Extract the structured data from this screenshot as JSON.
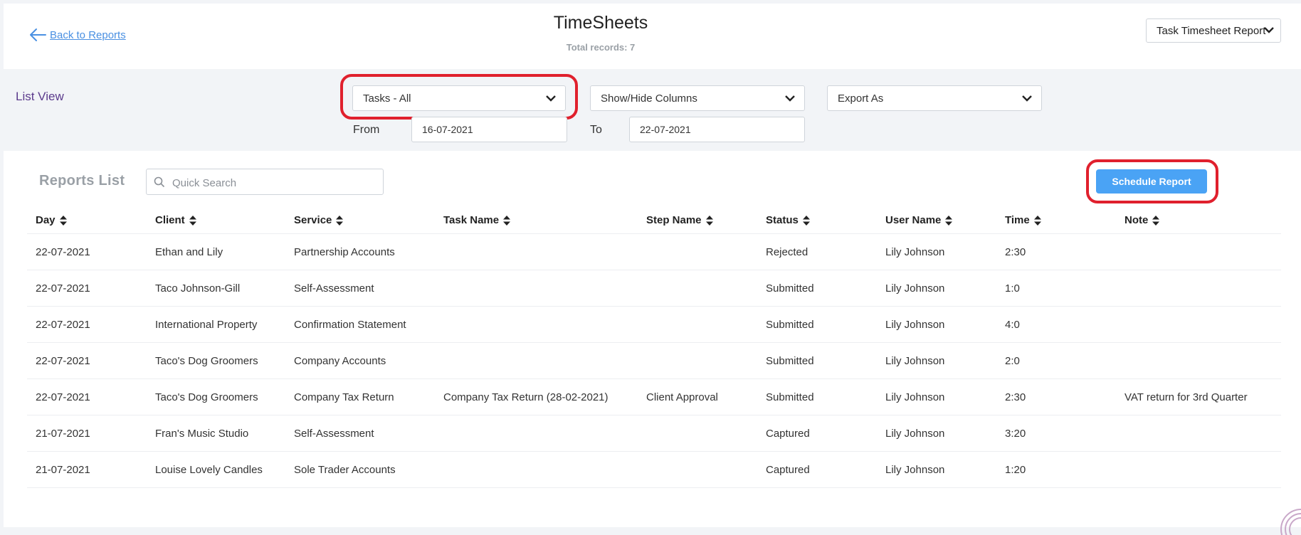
{
  "header": {
    "back_link": "Back to Reports",
    "title": "TimeSheets",
    "total_records": "Total records: 7",
    "report_select": "Task Timesheet Report"
  },
  "filters": {
    "list_view_label": "List View",
    "tasks_dropdown": "Tasks - All",
    "columns_dropdown": "Show/Hide Columns",
    "export_dropdown": "Export As",
    "from_label": "From",
    "from_date": "16-07-2021",
    "to_label": "To",
    "to_date": "22-07-2021"
  },
  "reports": {
    "title": "Reports List",
    "search_placeholder": "Quick Search",
    "schedule_button": "Schedule Report",
    "columns": [
      "Day",
      "Client",
      "Service",
      "Task Name",
      "Step Name",
      "Status",
      "User Name",
      "Time",
      "Note"
    ],
    "rows": [
      [
        "22-07-2021",
        "Ethan and Lily",
        "Partnership Accounts",
        "",
        "",
        "Rejected",
        "Lily Johnson",
        "2:30",
        ""
      ],
      [
        "22-07-2021",
        "Taco Johnson-Gill",
        "Self-Assessment",
        "",
        "",
        "Submitted",
        "Lily Johnson",
        "1:0",
        ""
      ],
      [
        "22-07-2021",
        "International Property",
        "Confirmation Statement",
        "",
        "",
        "Submitted",
        "Lily Johnson",
        "4:0",
        ""
      ],
      [
        "22-07-2021",
        "Taco's Dog Groomers",
        "Company Accounts",
        "",
        "",
        "Submitted",
        "Lily Johnson",
        "2:0",
        ""
      ],
      [
        "22-07-2021",
        "Taco's Dog Groomers",
        "Company Tax Return",
        "Company Tax Return (28-02-2021)",
        "Client Approval",
        "Submitted",
        "Lily Johnson",
        "2:30",
        "VAT return for 3rd Quarter"
      ],
      [
        "21-07-2021",
        "Fran's Music Studio",
        "Self-Assessment",
        "",
        "",
        "Captured",
        "Lily Johnson",
        "3:20",
        ""
      ],
      [
        "21-07-2021",
        "Louise Lovely Candles",
        "Sole Trader Accounts",
        "",
        "",
        "Captured",
        "Lily Johnson",
        "1:20",
        ""
      ]
    ]
  },
  "colors": {
    "accent": "#4aa3f5",
    "highlight": "#e0202d",
    "list_view": "#5b3a8c",
    "link": "#4a90e2"
  }
}
